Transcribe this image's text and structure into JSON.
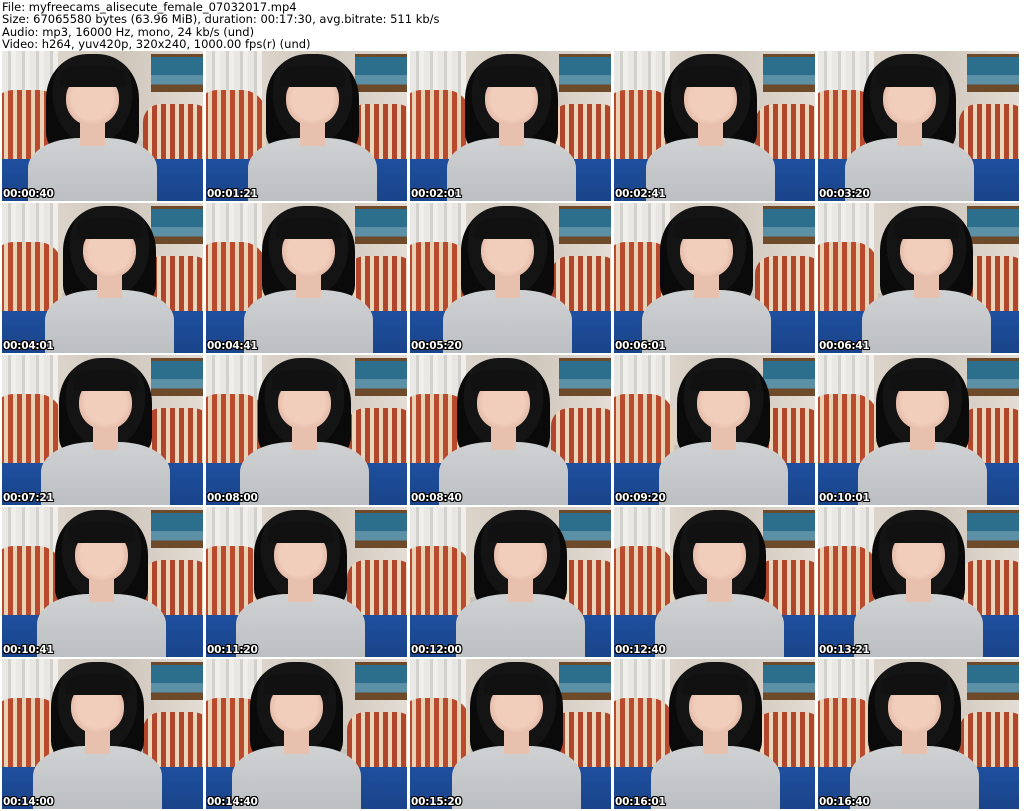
{
  "header": {
    "line1": "File: myfreecams_alisecute_female_07032017.mp4",
    "line2": "Size: 67065580 bytes (63.96 MiB), duration: 00:17:30, avg.bitrate: 511 kb/s",
    "line3": "Audio: mp3, 16000 Hz, mono, 24 kb/s (und)",
    "line4": "Video: h264, yuv420p, 320x240, 1000.00 fps(r) (und)"
  },
  "thumbnails": [
    "00:00:40",
    "00:01:21",
    "00:02:01",
    "00:02:41",
    "00:03:20",
    "00:04:01",
    "00:04:41",
    "00:05:20",
    "00:06:01",
    "00:06:41",
    "00:07:21",
    "00:08:00",
    "00:08:40",
    "00:09:20",
    "00:10:01",
    "00:10:41",
    "00:11:20",
    "00:12:00",
    "00:12:40",
    "00:13:21",
    "00:14:00",
    "00:14:40",
    "00:15:20",
    "00:16:01",
    "00:16:40"
  ]
}
